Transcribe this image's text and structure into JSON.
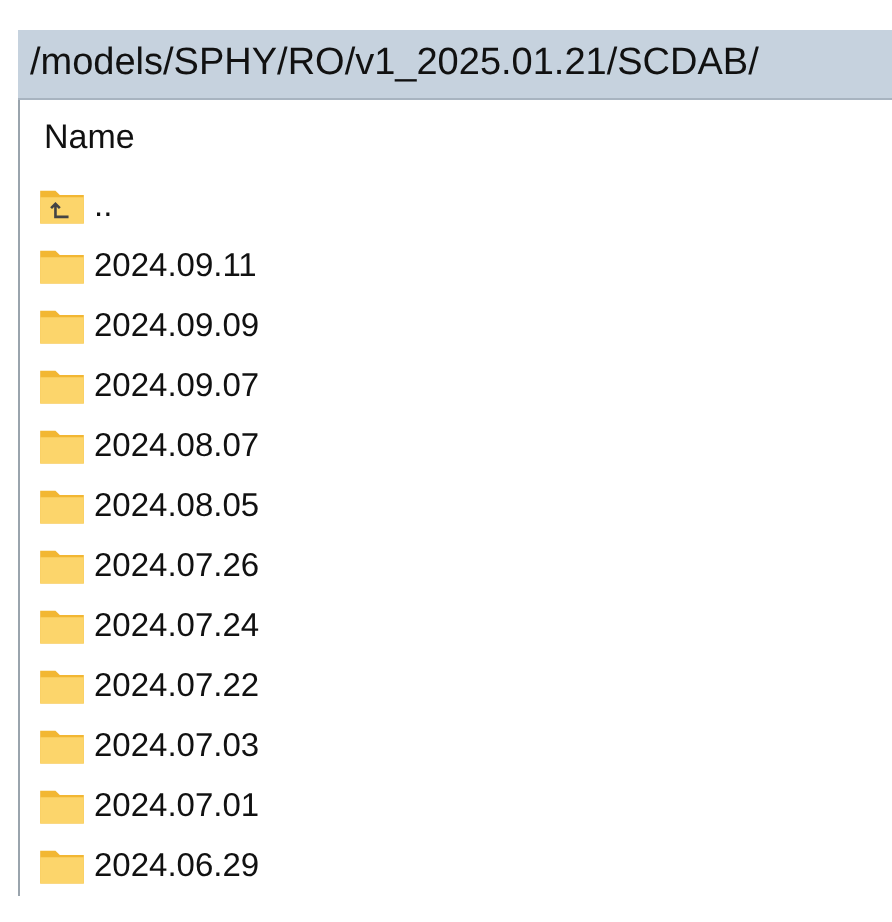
{
  "path_bar": {
    "text": "/models/SPHY/RO/v1_2025.01.21/SCDAB/"
  },
  "file_list": {
    "columns": [
      "Name"
    ],
    "items": [
      {
        "kind": "parent",
        "name": ".."
      },
      {
        "kind": "folder",
        "name": "2024.09.11"
      },
      {
        "kind": "folder",
        "name": "2024.09.09"
      },
      {
        "kind": "folder",
        "name": "2024.09.07"
      },
      {
        "kind": "folder",
        "name": "2024.08.07"
      },
      {
        "kind": "folder",
        "name": "2024.08.05"
      },
      {
        "kind": "folder",
        "name": "2024.07.26"
      },
      {
        "kind": "folder",
        "name": "2024.07.24"
      },
      {
        "kind": "folder",
        "name": "2024.07.22"
      },
      {
        "kind": "folder",
        "name": "2024.07.03"
      },
      {
        "kind": "folder",
        "name": "2024.07.01"
      },
      {
        "kind": "folder",
        "name": "2024.06.29"
      }
    ]
  }
}
